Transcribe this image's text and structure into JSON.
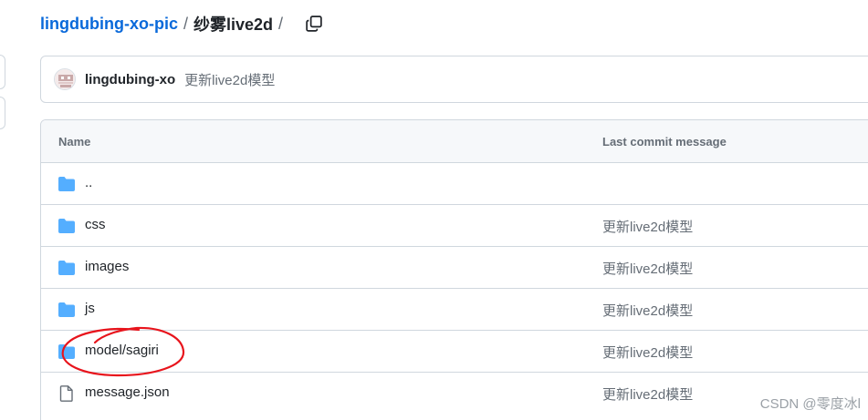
{
  "breadcrumb": {
    "repo": "lingdubing-xo-pic",
    "separator": "/",
    "folder": "纱雾live2d",
    "trailing_separator": "/"
  },
  "commit": {
    "author": "lingdubing-xo",
    "message": "更新live2d模型"
  },
  "table": {
    "header": {
      "name": "Name",
      "last_commit": "Last commit message"
    },
    "rows": [
      {
        "type": "folder",
        "name": "..",
        "message": ""
      },
      {
        "type": "folder",
        "name": "css",
        "message": "更新live2d模型"
      },
      {
        "type": "folder",
        "name": "images",
        "message": "更新live2d模型"
      },
      {
        "type": "folder",
        "name": "js",
        "message": "更新live2d模型"
      },
      {
        "type": "folder",
        "name": "model/sagiri",
        "message": "更新live2d模型"
      },
      {
        "type": "file",
        "name": "message.json",
        "message": "更新live2d模型"
      }
    ]
  },
  "watermark": "CSDN @零度冰l",
  "colors": {
    "link": "#0969da",
    "folder": "#54aeff",
    "annotation": "#e8141c"
  }
}
